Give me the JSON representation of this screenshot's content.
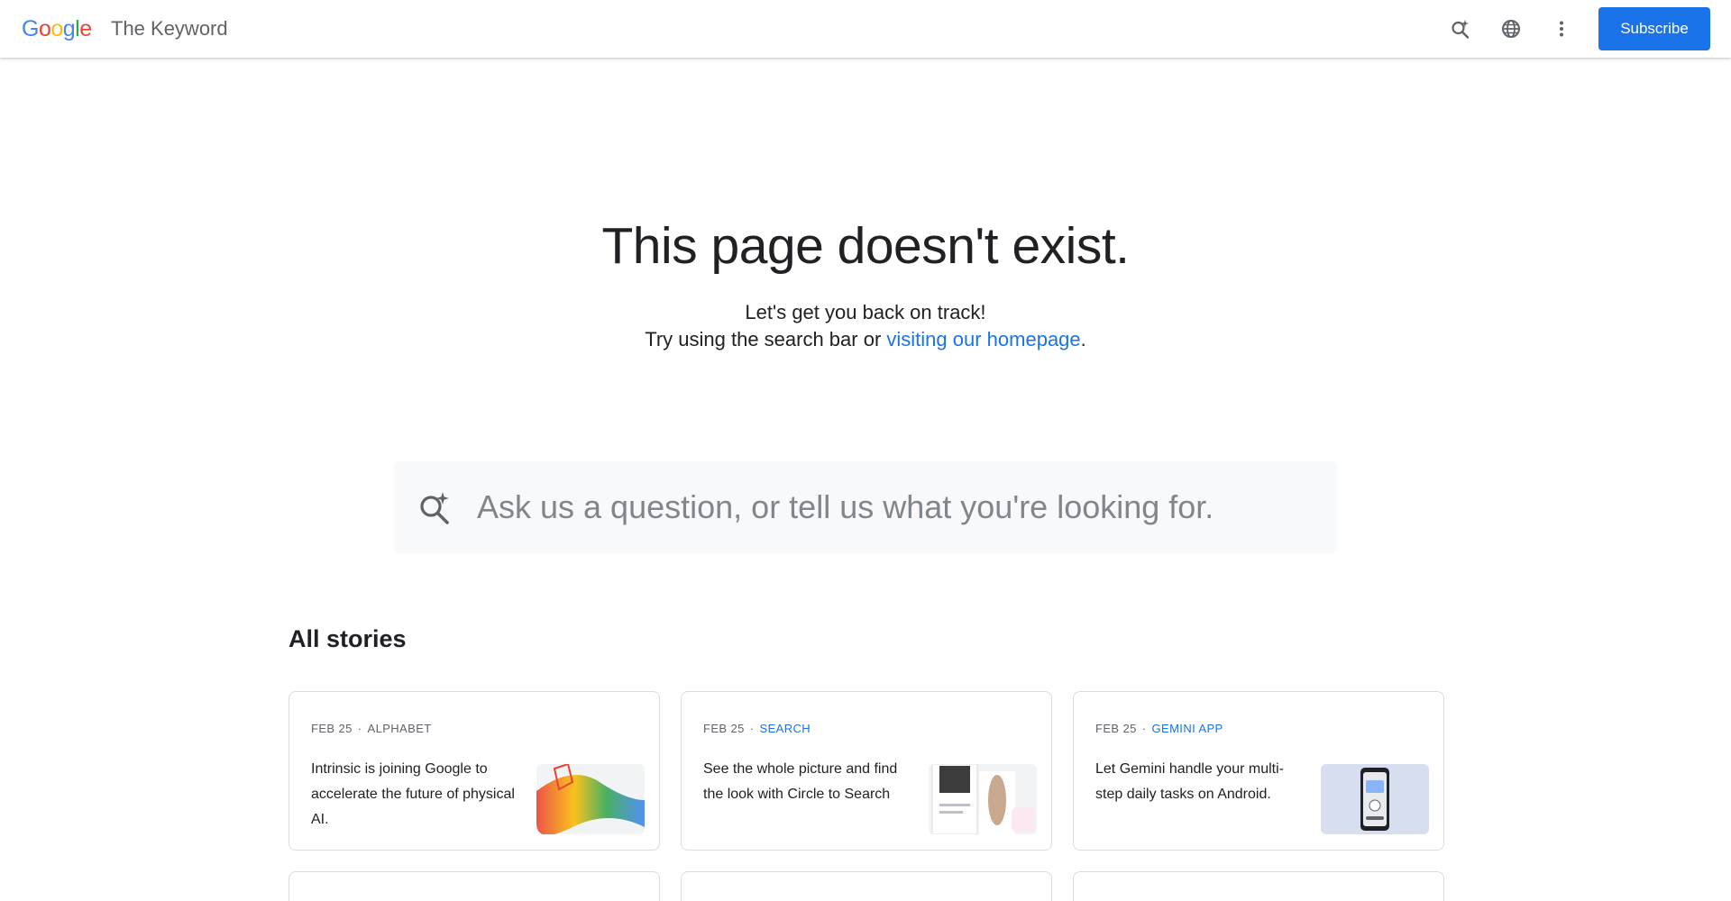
{
  "header": {
    "logo_letters": [
      "G",
      "o",
      "o",
      "g",
      "l",
      "e"
    ],
    "logo_colors": [
      "#4285f4",
      "#ea4335",
      "#fbbc05",
      "#4285f4",
      "#34a853",
      "#ea4335"
    ],
    "site_title": "The Keyword",
    "icons": [
      "ai-search-icon",
      "globe-icon",
      "more-vert-icon"
    ],
    "subscribe_label": "Subscribe"
  },
  "hero": {
    "title": "This page doesn't exist.",
    "line1": "Let's get you back on track!",
    "line2_prefix": "Try using the search bar or ",
    "link_text": "visiting our homepage",
    "line2_suffix": "."
  },
  "search": {
    "placeholder": "Ask us a question, or tell us what you're looking for.",
    "value": ""
  },
  "stories": {
    "title": "All stories",
    "cards": [
      {
        "date": "FEB 25",
        "category": "ALPHABET",
        "category_is_link": false,
        "headline": "Intrinsic is joining Google to accelerate the future of physical AI."
      },
      {
        "date": "FEB 25",
        "category": "SEARCH",
        "category_is_link": true,
        "headline": "See the whole picture and find the look with Circle to Search"
      },
      {
        "date": "FEB 25",
        "category": "GEMINI APP",
        "category_is_link": true,
        "headline": "Let Gemini handle your multi-step daily tasks on Android."
      }
    ]
  },
  "colors": {
    "accent": "#1a73e8",
    "text": "#202124",
    "muted": "#5f6368",
    "search_bg": "#f8f9fa",
    "card_border": "#dadce0"
  }
}
